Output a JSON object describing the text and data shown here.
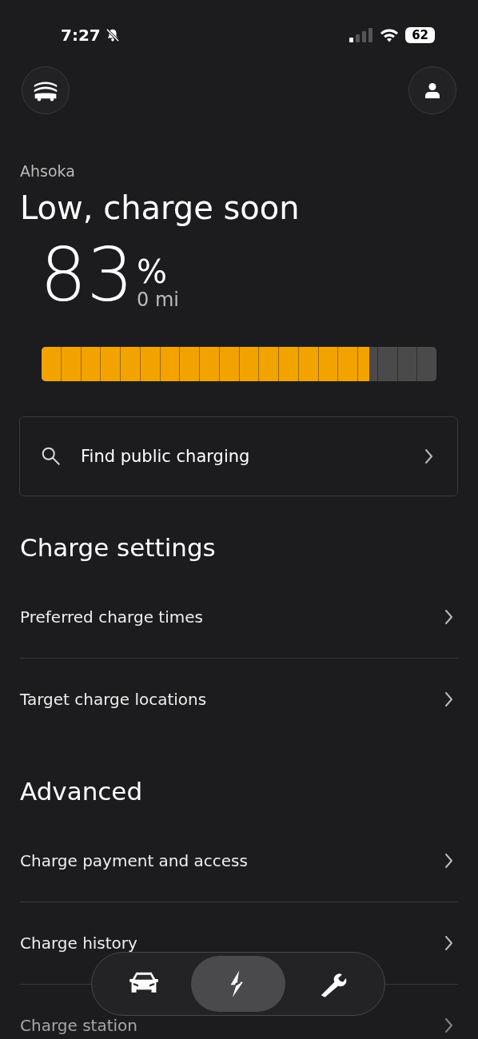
{
  "status_bar": {
    "time": "7:27",
    "battery": "62"
  },
  "vehicle": {
    "name": "Ahsoka",
    "status": "Low, charge soon",
    "percent": "83",
    "percent_sign": "%",
    "range": "0 mi",
    "level": 0.83
  },
  "search_card": {
    "label": "Find public charging"
  },
  "sections": [
    {
      "title": "Charge settings",
      "items": [
        {
          "label": "Preferred charge times"
        },
        {
          "label": "Target charge locations"
        }
      ]
    },
    {
      "title": "Advanced",
      "items": [
        {
          "label": "Charge payment and access"
        },
        {
          "label": "Charge history"
        },
        {
          "label": "Charge station"
        }
      ]
    }
  ],
  "nav": [
    {
      "kind": "car",
      "selected": false
    },
    {
      "kind": "bolt",
      "selected": true
    },
    {
      "kind": "wrench",
      "selected": false
    }
  ]
}
